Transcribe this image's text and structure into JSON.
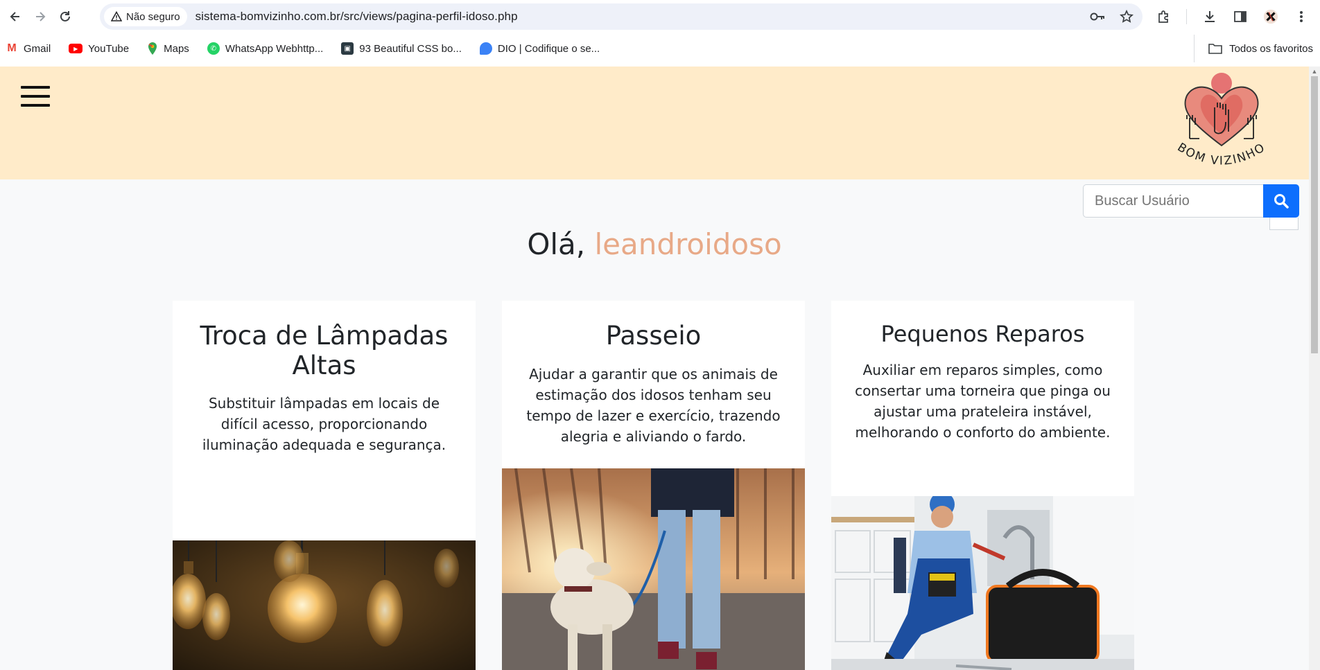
{
  "browser": {
    "security_label": "Não seguro",
    "url": "sistema-bomvizinho.com.br/src/views/pagina-perfil-idoso.php",
    "bookmarks": [
      {
        "label": "Gmail",
        "icon": "gmail-icon",
        "color": "#ea4335"
      },
      {
        "label": "YouTube",
        "icon": "youtube-icon",
        "color": "#ff0000"
      },
      {
        "label": "Maps",
        "icon": "maps-icon",
        "color": "#34a853"
      },
      {
        "label": "WhatsApp Webhttp...",
        "icon": "whatsapp-icon",
        "color": "#25d366"
      },
      {
        "label": "93 Beautiful CSS bo...",
        "icon": "codepen-icon",
        "color": "#2b3a42"
      },
      {
        "label": "DIO | Codifique o se...",
        "icon": "dio-icon",
        "color": "#3b82f6"
      }
    ],
    "all_bookmarks_label": "Todos os favoritos"
  },
  "site": {
    "logo_text": "BOM VIZINHO",
    "search": {
      "placeholder": "Buscar Usuário"
    },
    "greeting_prefix": "Olá, ",
    "username": "leandroidoso",
    "colors": {
      "header_bg": "#ffebc9",
      "accent": "#e8a987",
      "primary": "#0d6efd"
    }
  },
  "services": [
    {
      "title": "Troca de Lâmpadas Altas",
      "description": "Substituir lâmpadas em locais de difícil acesso, proporcionando iluminação adequada e segurança.",
      "image": "light-bulbs-photo"
    },
    {
      "title": "Passeio",
      "description": "Ajudar a garantir que os animais de estimação dos idosos tenham seu tempo de lazer e exercício, trazendo alegria e aliviando o fardo.",
      "image": "dog-walk-photo"
    },
    {
      "title": "Pequenos Reparos",
      "description": "Auxiliar em reparos simples, como consertar uma torneira que pinga ou ajustar uma prateleira instável, melhorando o conforto do ambiente.",
      "image": "plumber-repair-photo"
    }
  ]
}
